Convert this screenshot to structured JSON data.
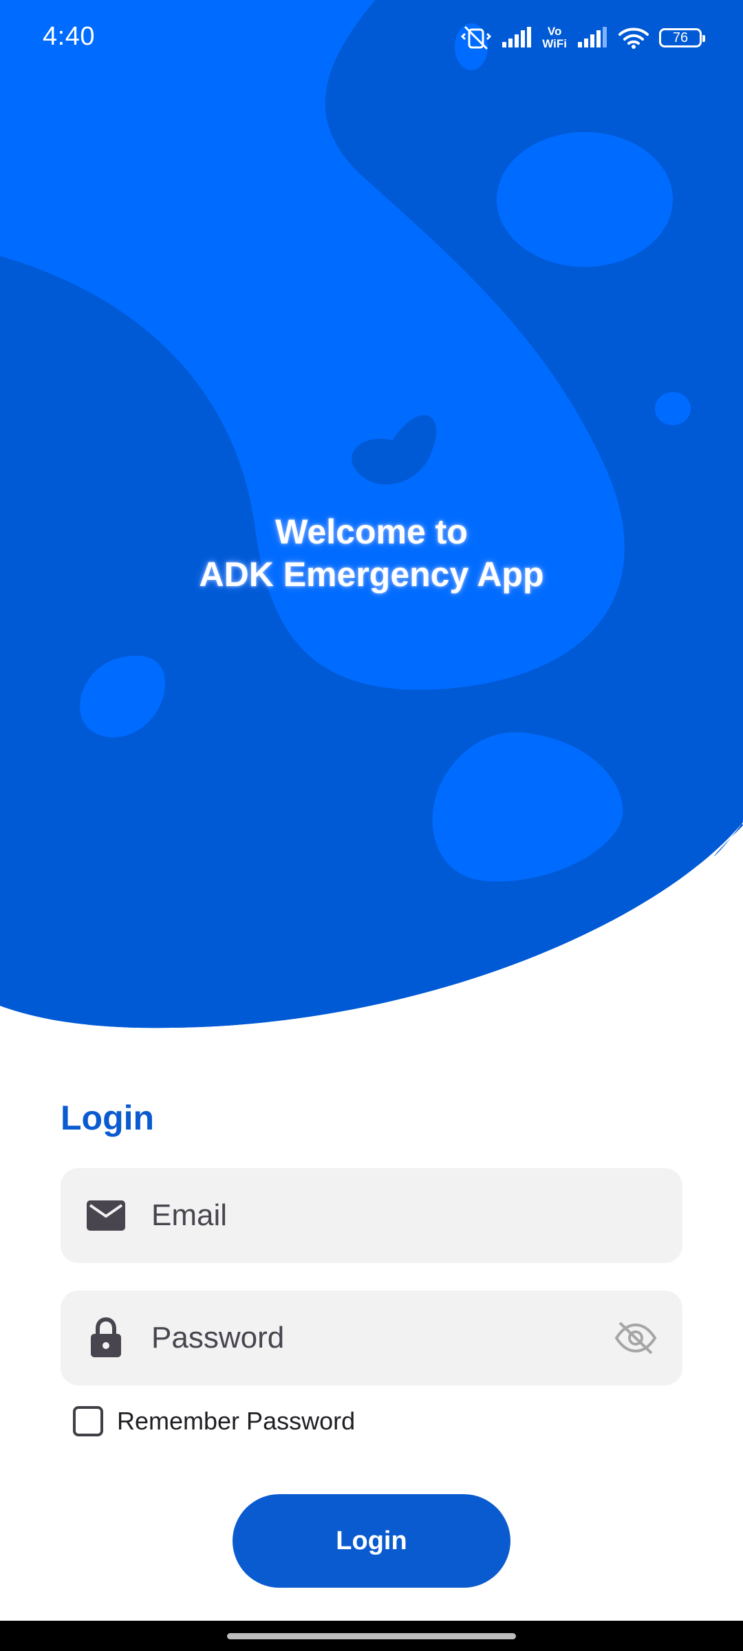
{
  "status_bar": {
    "time": "4:40",
    "vowifi_top": "Vo",
    "vowifi_bottom": "WiFi",
    "battery_level": "76",
    "icons": [
      "muted-vibrate-icon",
      "signal-icon",
      "vowifi-icon",
      "signal-icon",
      "wifi-icon",
      "battery-icon"
    ]
  },
  "hero": {
    "welcome_line1": "Welcome to",
    "welcome_line2": "ADK Emergency App"
  },
  "login": {
    "heading": "Login",
    "email_placeholder": "Email",
    "password_placeholder": "Password",
    "remember_label": "Remember Password",
    "remember_checked": false,
    "button_label": "Login"
  },
  "colors": {
    "primary": "#0a5bd0",
    "hero_dark": "#005ad6",
    "hero_light": "#006cff",
    "field_bg": "#f2f2f2"
  }
}
